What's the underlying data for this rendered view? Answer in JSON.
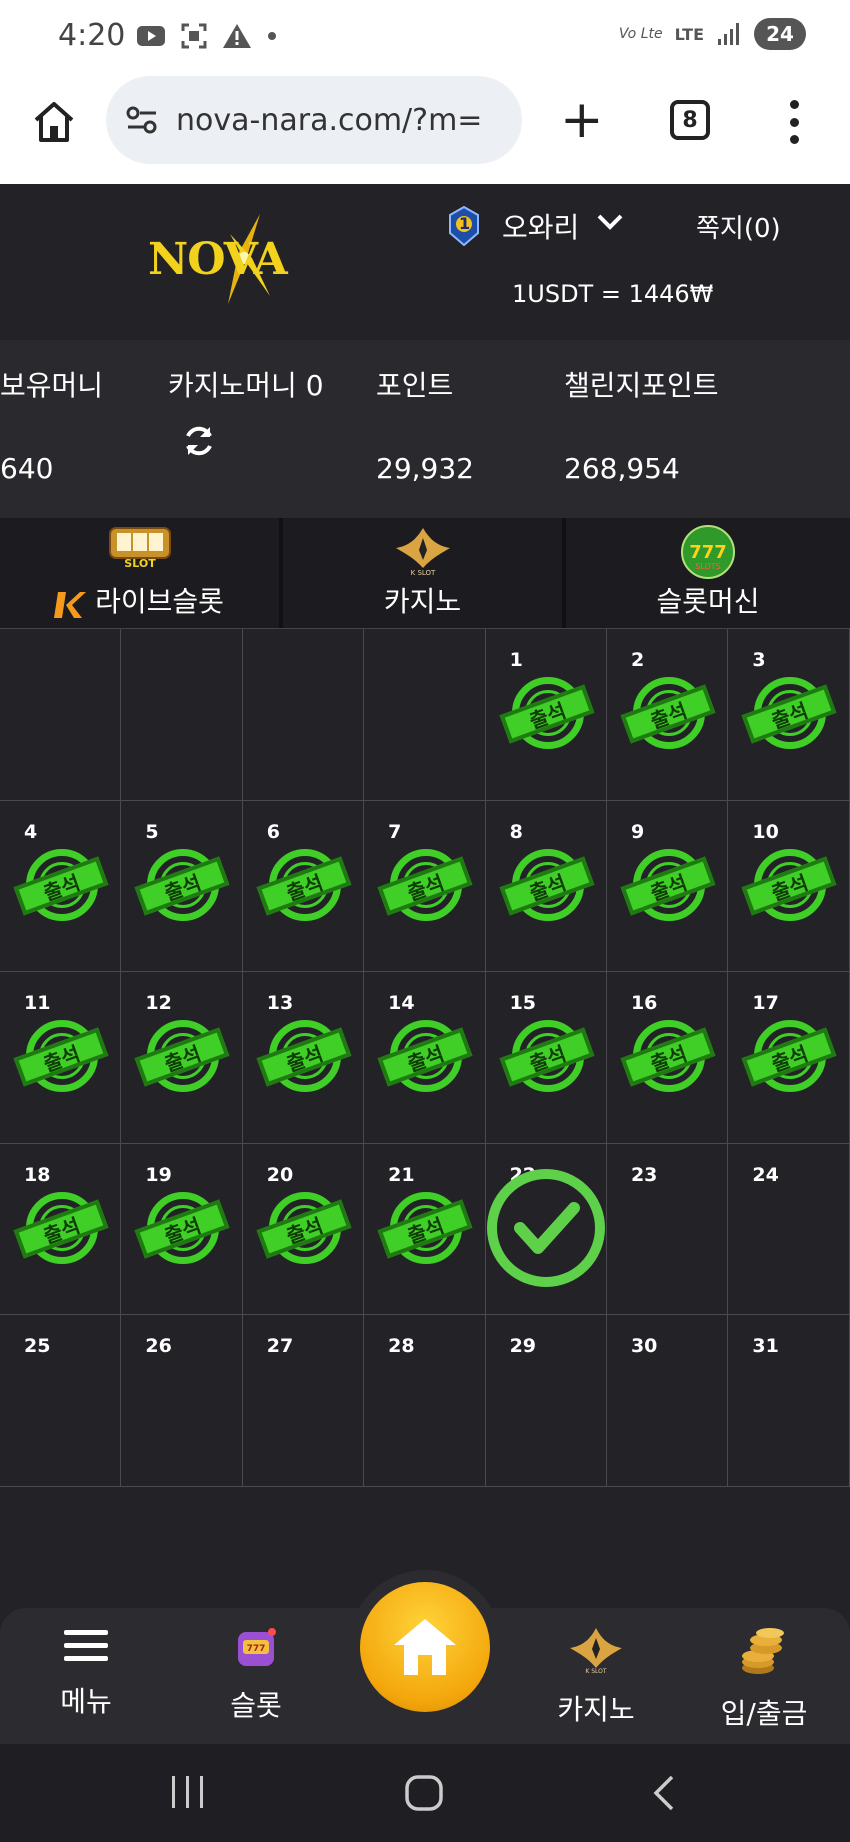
{
  "status_bar": {
    "time": "4:20",
    "network": "LTE",
    "volte": "Vo Lte",
    "battery": "24"
  },
  "browser": {
    "url": "nova-nara.com/?m=",
    "tab_count": "8"
  },
  "header": {
    "logo_text": "NOVA",
    "rank_level": "1",
    "username": "오와리",
    "messages": "쪽지(0)",
    "rate": "1USDT = 1446₩"
  },
  "balances": {
    "holding_label": "보유머니",
    "holding_value": "640",
    "casino_label": "카지노머니 0",
    "point_label": "포인트",
    "point_value": "29,932",
    "challenge_label": "챌린지포인트",
    "challenge_value": "268,954"
  },
  "game_tabs": [
    {
      "label": "라이브슬롯",
      "icon": "live-slot-icon"
    },
    {
      "label": "카지노",
      "icon": "k-slot-icon"
    },
    {
      "label": "슬롯머신",
      "icon": "777-slots-icon"
    }
  ],
  "calendar": {
    "stamp_text": "출석",
    "leading_blanks": 4,
    "days": [
      {
        "d": "1",
        "state": "stamp"
      },
      {
        "d": "2",
        "state": "stamp"
      },
      {
        "d": "3",
        "state": "stamp"
      },
      {
        "d": "4",
        "state": "stamp"
      },
      {
        "d": "5",
        "state": "stamp"
      },
      {
        "d": "6",
        "state": "stamp"
      },
      {
        "d": "7",
        "state": "stamp"
      },
      {
        "d": "8",
        "state": "stamp"
      },
      {
        "d": "9",
        "state": "stamp"
      },
      {
        "d": "10",
        "state": "stamp"
      },
      {
        "d": "11",
        "state": "stamp"
      },
      {
        "d": "12",
        "state": "stamp"
      },
      {
        "d": "13",
        "state": "stamp"
      },
      {
        "d": "14",
        "state": "stamp"
      },
      {
        "d": "15",
        "state": "stamp"
      },
      {
        "d": "16",
        "state": "stamp"
      },
      {
        "d": "17",
        "state": "stamp"
      },
      {
        "d": "18",
        "state": "stamp"
      },
      {
        "d": "19",
        "state": "stamp"
      },
      {
        "d": "20",
        "state": "stamp"
      },
      {
        "d": "21",
        "state": "stamp"
      },
      {
        "d": "22",
        "state": "check"
      },
      {
        "d": "23",
        "state": "none"
      },
      {
        "d": "24",
        "state": "none"
      },
      {
        "d": "25",
        "state": "none"
      },
      {
        "d": "26",
        "state": "none"
      },
      {
        "d": "27",
        "state": "none"
      },
      {
        "d": "28",
        "state": "none"
      },
      {
        "d": "29",
        "state": "none"
      },
      {
        "d": "30",
        "state": "none"
      },
      {
        "d": "31",
        "state": "none"
      }
    ]
  },
  "bottom_nav": {
    "menu": "메뉴",
    "slot": "슬롯",
    "casino": "카지노",
    "deposit": "입/출금"
  },
  "colors": {
    "stamp_green": "#3fcf27",
    "gold": "#f3a60b",
    "background": "#222227"
  }
}
